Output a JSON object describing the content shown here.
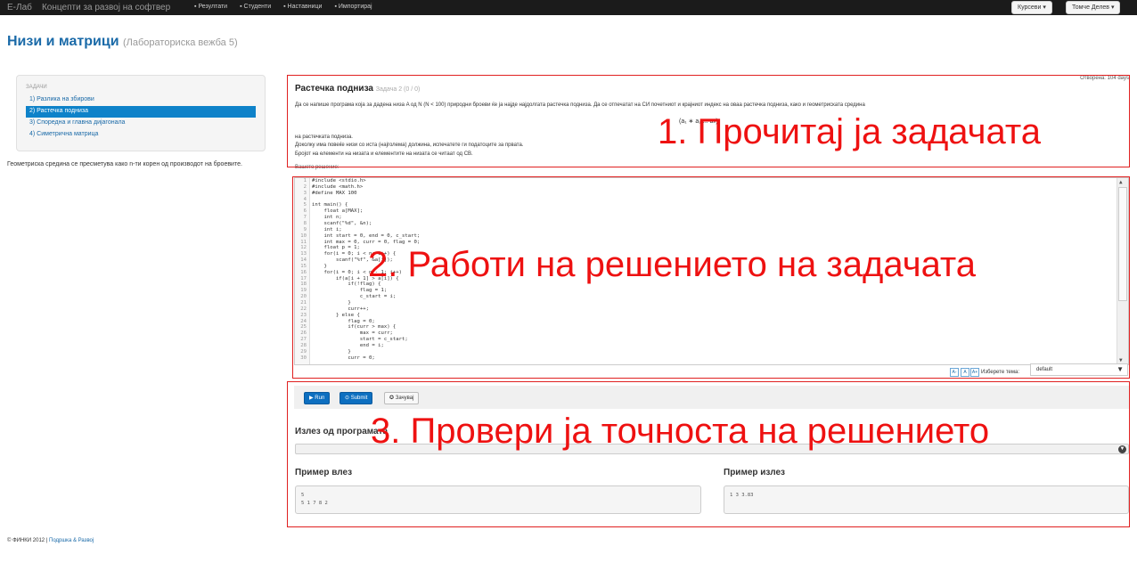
{
  "navbar": {
    "brand": "Е-Лаб",
    "subtitle": "Концепти за развој на софтвер",
    "items": [
      "Резултати",
      "Студенти",
      "Наставници",
      "Импортирај"
    ],
    "courses_btn": "Курсеви ▾",
    "user_btn": "Томче Делев ▾"
  },
  "page": {
    "title": "Низи и матрици",
    "subtitle": "(Лабораториска вежба 5)"
  },
  "sidebar": {
    "header": "задачи",
    "items": [
      {
        "label": "1) Разлика на збирови",
        "active": false
      },
      {
        "label": "2) Растечка подниза",
        "active": true
      },
      {
        "label": "3) Споредна и главна дијагонала",
        "active": false
      },
      {
        "label": "4) Симетрична матрица",
        "active": false
      }
    ],
    "note": "Геометриска средина се пресметува како n-ти корен од производот на броевите."
  },
  "problem": {
    "title": "Растечка подниза",
    "badge": "Задача 2 (0 / 0)",
    "opened": "Отворена: 104 days",
    "description": "Да се напише програма која за дадена низа A од N (N < 100) природни броеви ќе ја најде најдолгата растечка подниза. Да се отпечатат на СИ почетниот и крајниот индекс на оваа растечка подниза, како и геометриската средина",
    "formula": "(a₁ ∗ a₂ ... aₙ)ⁿ",
    "line2": "на растечката подниза.",
    "line3": "Доколку има повеќе низи со иста (најголема) должина, испечатете ги податоците за првата.",
    "line4": "Бројот на елементи на низата и елементите на низата се читаат од СВ.",
    "your_solution": "Вашето решение:"
  },
  "editor": {
    "lines": [
      "#include <stdio.h>",
      "#include <math.h>",
      "#define MAX 100",
      "",
      "int main() {",
      "    float a[MAX];",
      "    int n;",
      "    scanf(\"%d\", &n);",
      "    int i;",
      "    int start = 0, end = 0, c_start;",
      "    int max = 0, curr = 0, flag = 0;",
      "    float p = 1;",
      "    for(i = 0; i < n; i++) {",
      "        scanf(\"%f\", &a[i]);",
      "    }",
      "    for(i = 0; i < n - 1; i++)",
      "        if(a[i + 1] > a[i]) {",
      "            if(!flag) {",
      "                flag = 1;",
      "                c_start = i;",
      "            }",
      "            curr++;",
      "        } else {",
      "            flag = 0;",
      "            if(curr > max) {",
      "                max = curr;",
      "                start = c_start;",
      "                end = i;",
      "            }",
      "            curr = 0;"
    ],
    "font_buttons": [
      "A-",
      "A",
      "A+"
    ],
    "theme_label": "Изберете тема:",
    "theme_value": "default"
  },
  "actions": {
    "run": "Run",
    "submit": "Submit",
    "save": "Зачувај"
  },
  "output": {
    "label": "Излез од програмата"
  },
  "examples": {
    "input_label": "Пример влез",
    "input_value": "5\n5 1 7 8 2",
    "output_label": "Пример излез",
    "output_value": "1 3 3.83"
  },
  "annotations": {
    "step1": "1. Прочитај ја задачата",
    "step2": "2. Работи на решението на задачата",
    "step3": "3. Провери ја точноста на решението",
    "color": "#ee1111"
  },
  "footer": {
    "copyright": "© ФИНКИ 2012 |",
    "link": "Подршка & Развој"
  }
}
